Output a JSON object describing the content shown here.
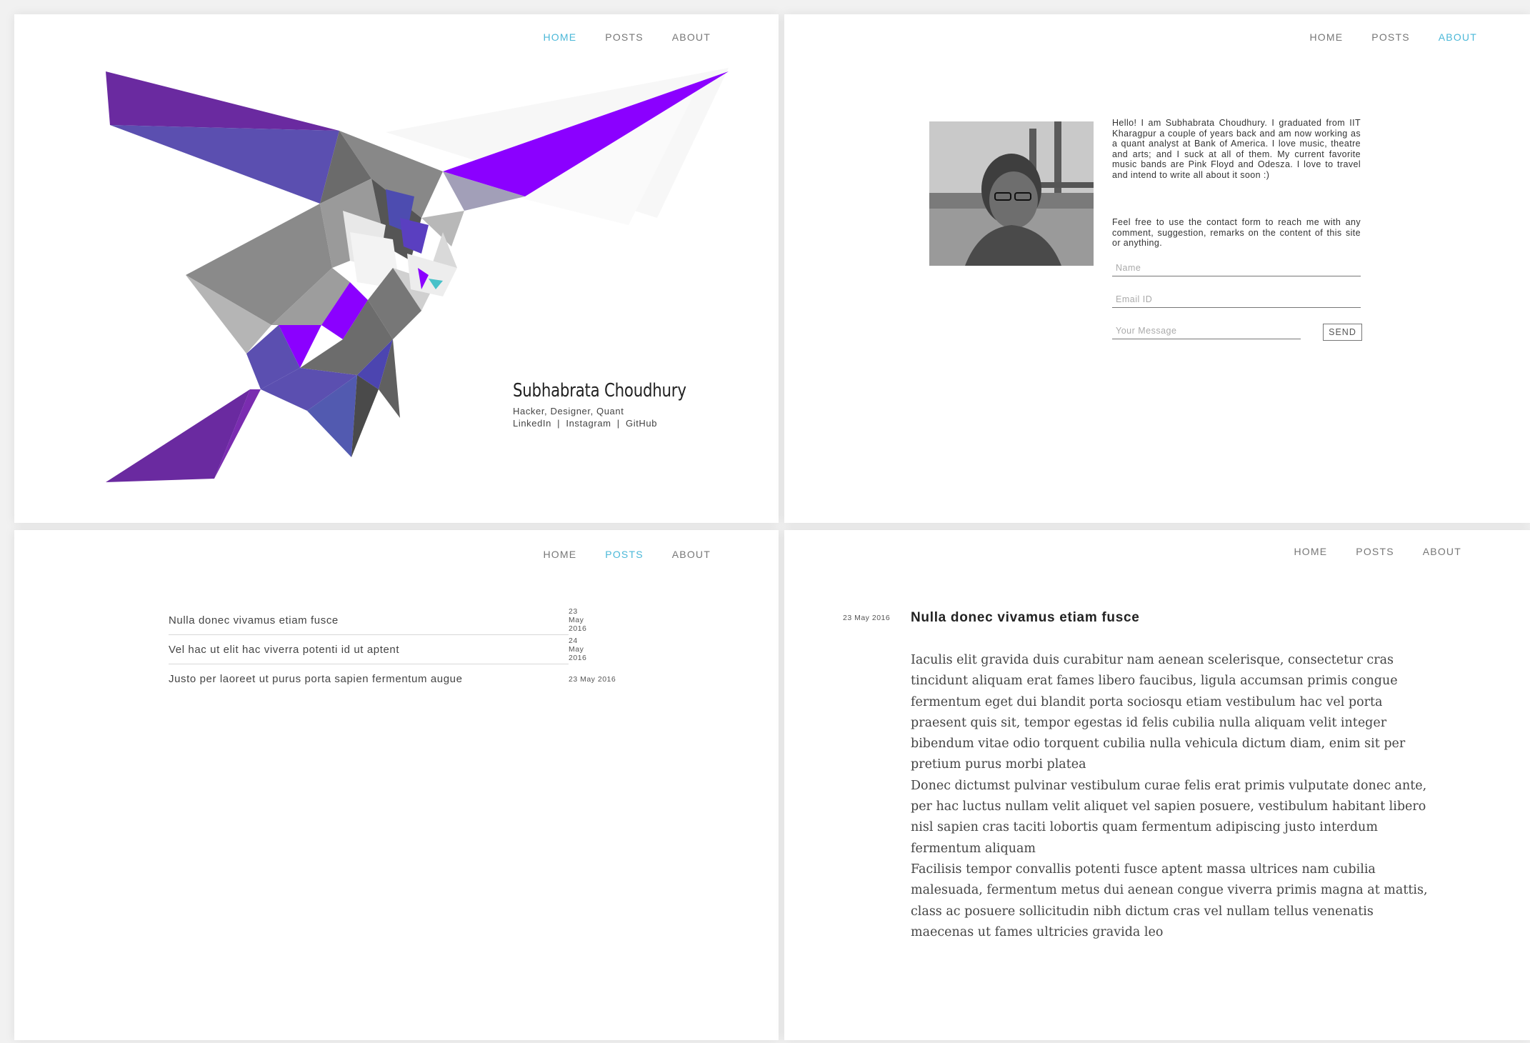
{
  "colors": {
    "accent": "#4bb8d8",
    "purple": "#8b00ff",
    "indigo": "#5b4fb0"
  },
  "nav": {
    "home": "HOME",
    "posts": "POSTS",
    "about": "ABOUT"
  },
  "home": {
    "name": "Subhabrata Choudhury",
    "tagline": "Hacker, Designer, Quant",
    "links": [
      "LinkedIn",
      "|",
      "Instagram",
      "|",
      "GitHub"
    ]
  },
  "about": {
    "bio": "Hello! I am Subhabrata Choudhury. I graduated from IIT Kharagpur a couple of years back and am now working as a quant analyst at Bank of America. I love music, theatre and arts; and I suck at all of them. My current favorite music bands are Pink Floyd and Odesza. I love to travel and intend to write all about it soon :)",
    "contact_note": "Feel free to use the contact form to reach me with any comment, suggestion, remarks on the content of this site or anything.",
    "form": {
      "name_placeholder": "Name",
      "email_placeholder": "Email ID",
      "message_placeholder": "Your Message",
      "send_label": "SEND"
    }
  },
  "posts": [
    {
      "title": "Nulla donec vivamus etiam fusce",
      "date": "23 May 2016"
    },
    {
      "title": "Vel hac ut elit hac viverra potenti id ut aptent",
      "date": "24 May 2016"
    },
    {
      "title": "Justo per laoreet ut purus porta sapien fermentum augue",
      "date": "23 May 2016"
    }
  ],
  "post_detail": {
    "date": "23 May 2016",
    "title": "Nulla donec vivamus etiam fusce",
    "paragraphs": [
      "Iaculis elit gravida duis curabitur nam aenean scelerisque, consectetur cras tincidunt aliquam erat fames libero faucibus, ligula accumsan primis congue fermentum eget dui blandit porta sociosqu etiam vestibulum hac vel porta praesent quis sit, tempor egestas id felis cubilia nulla aliquam velit integer bibendum vitae odio torquent cubilia nulla vehicula dictum diam, enim sit per pretium purus morbi platea",
      "Donec dictumst pulvinar vestibulum curae felis erat primis vulputate donec ante, per hac luctus nullam velit aliquet vel sapien posuere, vestibulum habitant libero nisl sapien cras taciti lobortis quam fermentum adipiscing justo interdum fermentum aliquam",
      "Facilisis tempor convallis potenti fusce aptent massa ultrices nam cubilia malesuada, fermentum metus dui aenean congue viverra primis magna at mattis, class ac posuere sollicitudin nibh dictum cras vel nullam tellus venenatis maecenas ut fames ultricies gravida leo"
    ]
  }
}
